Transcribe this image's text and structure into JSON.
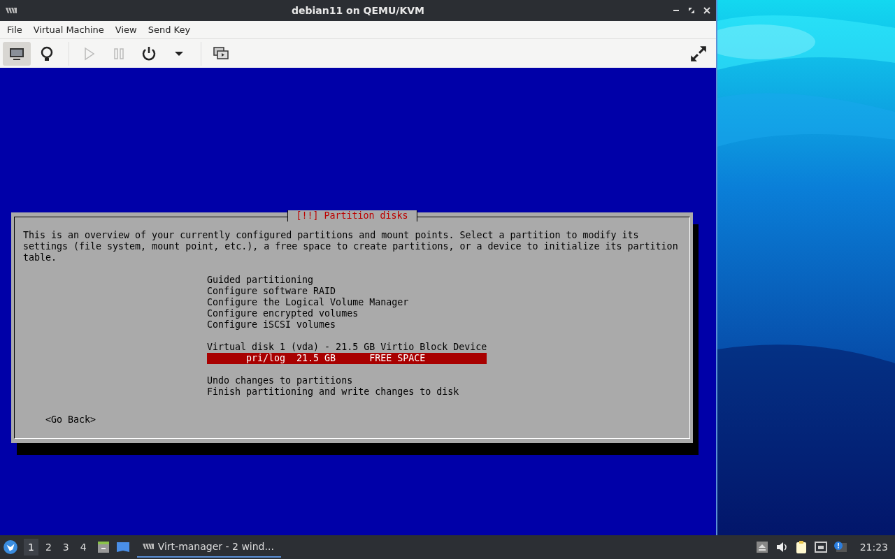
{
  "window": {
    "title": "debian11 on QEMU/KVM"
  },
  "menu": [
    "File",
    "Virtual Machine",
    "View",
    "Send Key"
  ],
  "toolbar": [
    {
      "kind": "console",
      "selected": true,
      "disabled": false
    },
    {
      "kind": "details",
      "selected": false,
      "disabled": false
    },
    {
      "kind": "run",
      "selected": false,
      "disabled": true
    },
    {
      "kind": "pause",
      "selected": false,
      "disabled": true
    },
    {
      "kind": "power",
      "selected": false,
      "disabled": false
    },
    {
      "kind": "caret",
      "selected": false,
      "disabled": false
    },
    {
      "kind": "snapshots",
      "selected": false,
      "disabled": false
    }
  ],
  "dialog": {
    "title": "[!!] Partition disks",
    "description": "This is an overview of your currently configured partitions and mount points. Select a partition to modify its settings (file system, mount point, etc.), a free space to create partitions, or a device to initialize its partition table.",
    "groups": [
      [
        {
          "label": "Guided partitioning",
          "selected": false
        },
        {
          "label": "Configure software RAID",
          "selected": false
        },
        {
          "label": "Configure the Logical Volume Manager",
          "selected": false
        },
        {
          "label": "Configure encrypted volumes",
          "selected": false
        },
        {
          "label": "Configure iSCSI volumes",
          "selected": false
        }
      ],
      [
        {
          "label": "Virtual disk 1 (vda) - 21.5 GB Virtio Block Device",
          "selected": false,
          "children": [
            {
              "label": "pri/log  21.5 GB      FREE SPACE",
              "selected": true
            }
          ]
        }
      ],
      [
        {
          "label": "Undo changes to partitions",
          "selected": false
        },
        {
          "label": "Finish partitioning and write changes to disk",
          "selected": false
        }
      ]
    ],
    "back_button": "<Go Back>"
  },
  "taskbar": {
    "workspaces": [
      {
        "label": "1",
        "selected": true
      },
      {
        "label": "2",
        "selected": false
      },
      {
        "label": "3",
        "selected": false
      },
      {
        "label": "4",
        "selected": false
      }
    ],
    "task": "Virt-manager - 2 wind...",
    "clock": "21:23"
  }
}
